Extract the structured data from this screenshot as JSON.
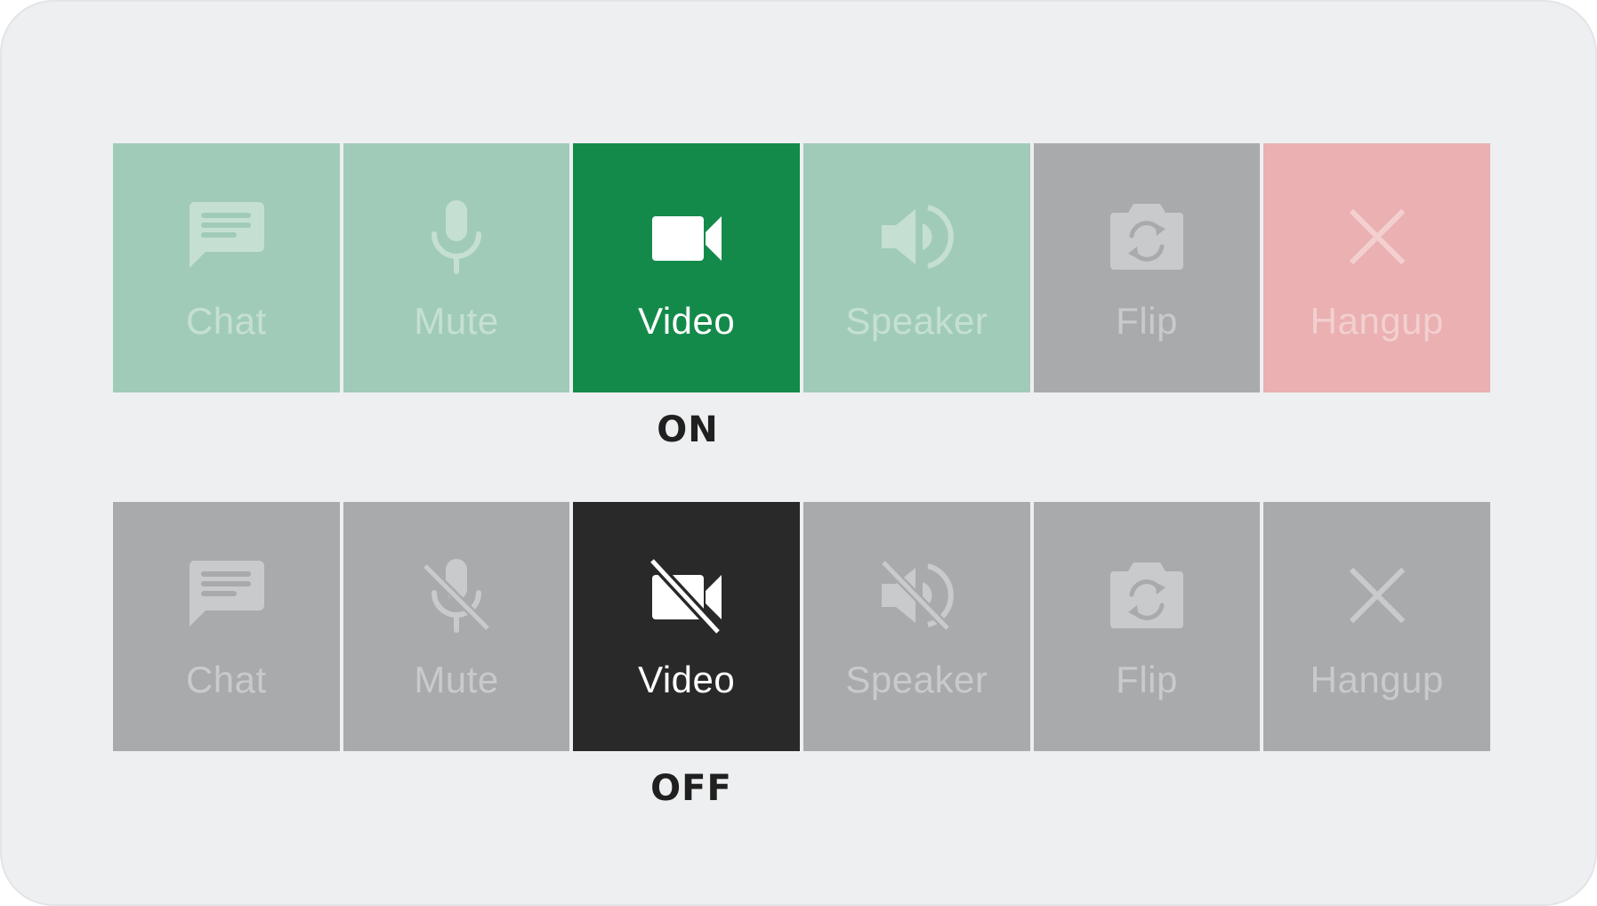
{
  "toolbars": [
    {
      "state_label": "ON",
      "buttons": [
        {
          "label": "Chat",
          "icon": "chat-icon",
          "bg": "#a1cbb9",
          "fg": "#c5e0d3",
          "active": false
        },
        {
          "label": "Mute",
          "icon": "microphone-icon",
          "bg": "#a1cbb9",
          "fg": "#c5e0d3",
          "active": false
        },
        {
          "label": "Video",
          "icon": "video-camera-icon",
          "bg": "#148a4a",
          "fg": "#ffffff",
          "active": true
        },
        {
          "label": "Speaker",
          "icon": "speaker-icon",
          "bg": "#a1cbb9",
          "fg": "#c5e0d3",
          "active": false
        },
        {
          "label": "Flip",
          "icon": "flip-camera-icon",
          "bg": "#a9aaac",
          "fg": "#c9cacb",
          "active": false
        },
        {
          "label": "Hangup",
          "icon": "close-icon",
          "bg": "#eab0b2",
          "fg": "#f3cfd0",
          "active": false
        }
      ]
    },
    {
      "state_label": "OFF",
      "buttons": [
        {
          "label": "Chat",
          "icon": "chat-icon",
          "bg": "#a9aaac",
          "fg": "#c9cacb",
          "active": false
        },
        {
          "label": "Mute",
          "icon": "microphone-off-icon",
          "bg": "#a9aaac",
          "fg": "#c9cacb",
          "active": false
        },
        {
          "label": "Video",
          "icon": "video-camera-off-icon",
          "bg": "#292929",
          "fg": "#ffffff",
          "active": true
        },
        {
          "label": "Speaker",
          "icon": "speaker-off-icon",
          "bg": "#a9aaac",
          "fg": "#c9cacb",
          "active": false
        },
        {
          "label": "Flip",
          "icon": "flip-camera-icon",
          "bg": "#a9aaac",
          "fg": "#c9cacb",
          "active": false
        },
        {
          "label": "Hangup",
          "icon": "close-icon",
          "bg": "#a9aaac",
          "fg": "#c9cacb",
          "active": false
        }
      ]
    }
  ]
}
